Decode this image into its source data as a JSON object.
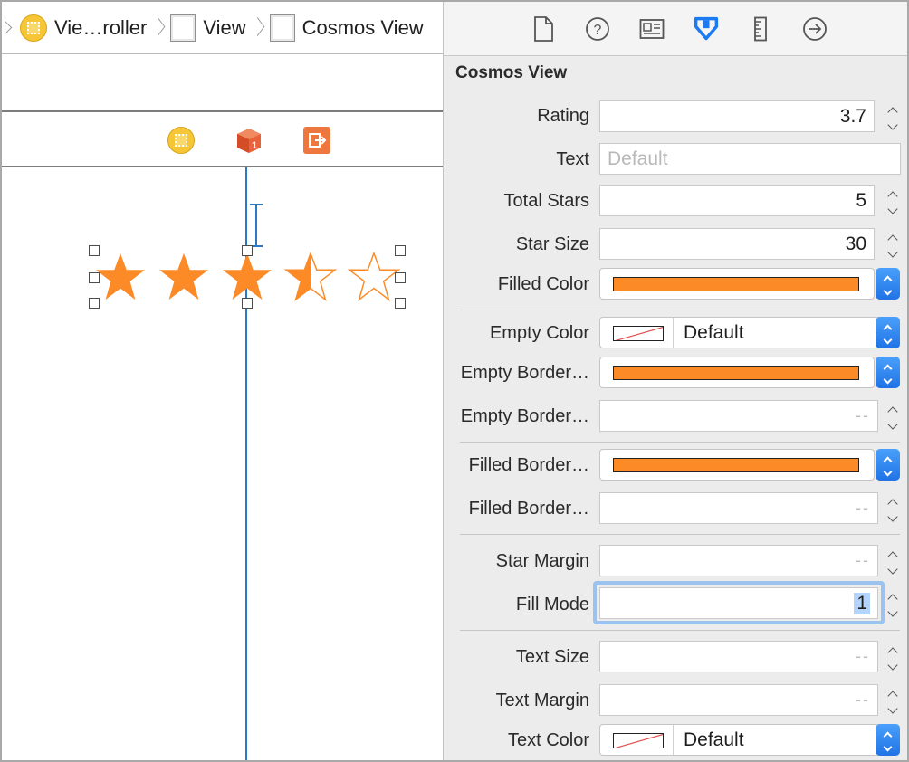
{
  "breadcrumb": {
    "items": [
      {
        "label": "Vie…roller",
        "icon": "view-controller-icon"
      },
      {
        "label": "View",
        "icon": "view-icon"
      },
      {
        "label": "Cosmos View",
        "icon": "view-icon"
      }
    ]
  },
  "scene_dock": {
    "icons": [
      "view-controller-icon",
      "first-responder-icon",
      "exit-icon"
    ]
  },
  "canvas": {
    "rating_preview": 3.5,
    "star_count": 5,
    "star_color": "#fc8a27"
  },
  "inspector": {
    "tabs": [
      "file-inspector-icon",
      "quick-help-icon",
      "identity-inspector-icon",
      "attributes-inspector-icon",
      "size-inspector-icon",
      "connections-inspector-icon"
    ],
    "active_tab": "attributes-inspector-icon",
    "section_title": "Cosmos View",
    "rating": {
      "label": "Rating",
      "value": "3.7"
    },
    "text": {
      "label": "Text",
      "placeholder": "Default"
    },
    "total_stars": {
      "label": "Total Stars",
      "value": "5"
    },
    "star_size": {
      "label": "Star Size",
      "value": "30"
    },
    "filled_color": {
      "label": "Filled Color",
      "color": "#fc8a27"
    },
    "empty_color": {
      "label": "Empty Color",
      "value": "Default"
    },
    "empty_border_color": {
      "label": "Empty Border…",
      "color": "#fc8a27"
    },
    "empty_border_width": {
      "label": "Empty Border…",
      "value": "--"
    },
    "filled_border_color": {
      "label": "Filled Border…",
      "color": "#fc8a27"
    },
    "filled_border_width": {
      "label": "Filled Border…",
      "value": "--"
    },
    "star_margin": {
      "label": "Star Margin",
      "value": "--"
    },
    "fill_mode": {
      "label": "Fill Mode",
      "value": "1"
    },
    "text_size": {
      "label": "Text Size",
      "value": "--"
    },
    "text_margin": {
      "label": "Text Margin",
      "value": "--"
    },
    "text_color": {
      "label": "Text Color",
      "value": "Default"
    }
  }
}
